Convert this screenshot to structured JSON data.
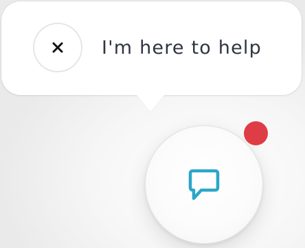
{
  "popup": {
    "message": "I'm here to help",
    "close_icon": "close-icon"
  },
  "launcher": {
    "icon": "chat-bubble-icon",
    "notification": {
      "visible": true,
      "color": "#df3d45"
    }
  },
  "colors": {
    "accent": "#2aa7c8",
    "text": "#2f3440",
    "badge": "#df3d45"
  }
}
